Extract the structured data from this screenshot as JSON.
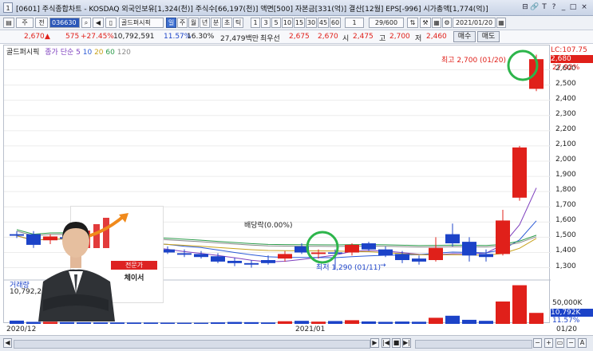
{
  "window": {
    "tab_number": "1",
    "title": "[0601] 주식종합차트 - KOSDAQ 외국인보유[1,324(천)] 주식수[66,197(천)] 액면[500] 자본금[331(억)] 결산[12월] EPS[-996] 시가총액[1,774(억)]",
    "controls": [
      "⊟",
      "🔗",
      "T",
      "?",
      "_",
      "□",
      "×"
    ]
  },
  "toolbar": {
    "market": "주",
    "jeon": "전",
    "stock_code": "036630",
    "stock_name": "골드퍼시픽",
    "periods": [
      "일",
      "주",
      "월",
      "년",
      "분",
      "초",
      "틱"
    ],
    "selected_period": "일",
    "minutes": [
      "1",
      "3",
      "5",
      "10",
      "15",
      "30",
      "45",
      "60"
    ],
    "interval_value": "1",
    "page_counter": "29/600",
    "date": "2021/01/20"
  },
  "pricebar": {
    "price": "2,670",
    "change": "575",
    "change_pct": "+27.45%",
    "volume": "10,792,591",
    "turnover": "11.57%",
    "rate2": "16.30%",
    "amount": "27,479백만",
    "best_sell_label": "최우선",
    "best_ask": "2,675",
    "best_bid": "2,670",
    "open_label": "시",
    "open": "2,475",
    "high_label": "고",
    "high": "2,700",
    "low_label": "저",
    "low": "2,460",
    "buy_button": "매수",
    "sell_button": "매도"
  },
  "legend": {
    "stock": "골드퍼시픽",
    "indicator": "종가 단순",
    "periods": [
      "5",
      "10",
      "20",
      "60",
      "120"
    ],
    "period_colors": [
      "#7e3fbe",
      "#2b5ad6",
      "#c8a21c",
      "#2b9b4a",
      "#8a8a8a"
    ]
  },
  "annotations": {
    "high": "최고 2,700 (01/20)",
    "low": "최저 1,290 (01/11)",
    "dividend": "배당락(0.00%)",
    "lc": "LC:107.75",
    "current_price_tag": "2,680",
    "current_pct_tag": "27.92%",
    "volume_label": "거래량",
    "volume_value": "10,792,23",
    "volume_tag": "10,792K",
    "volume_pct_tag": "11.57%",
    "vol_tick": "50,000K",
    "date_left": "2020/12",
    "date_mid": "2021/01",
    "date_right": "01/20"
  },
  "promo": {
    "title": "전문가",
    "name": "체이서"
  },
  "chart_data": {
    "type": "candlestick",
    "yaxis_ticks": [
      "2,600",
      "2,500",
      "2,400",
      "2,300",
      "2,200",
      "2,100",
      "2,000",
      "1,900",
      "1,800",
      "1,700",
      "1,600",
      "1,500",
      "1,400",
      "1,300"
    ],
    "ylim": [
      1240,
      2760
    ],
    "candles": [
      {
        "o": 1520,
        "h": 1540,
        "l": 1495,
        "c": 1510
      },
      {
        "o": 1520,
        "h": 1540,
        "l": 1430,
        "c": 1450
      },
      {
        "o": 1480,
        "h": 1520,
        "l": 1455,
        "c": 1505
      },
      {
        "o": 1500,
        "h": 1520,
        "l": 1460,
        "c": 1490
      },
      {
        "o": 1490,
        "h": 1510,
        "l": 1450,
        "c": 1470
      },
      {
        "o": 1470,
        "h": 1495,
        "l": 1440,
        "c": 1460
      },
      {
        "o": 1455,
        "h": 1480,
        "l": 1420,
        "c": 1430
      },
      {
        "o": 1440,
        "h": 1460,
        "l": 1400,
        "c": 1410
      },
      {
        "o": 1430,
        "h": 1450,
        "l": 1400,
        "c": 1405
      },
      {
        "o": 1420,
        "h": 1440,
        "l": 1390,
        "c": 1400
      },
      {
        "o": 1395,
        "h": 1420,
        "l": 1370,
        "c": 1385
      },
      {
        "o": 1390,
        "h": 1410,
        "l": 1360,
        "c": 1370
      },
      {
        "o": 1375,
        "h": 1395,
        "l": 1330,
        "c": 1340
      },
      {
        "o": 1345,
        "h": 1365,
        "l": 1310,
        "c": 1330
      },
      {
        "o": 1330,
        "h": 1350,
        "l": 1300,
        "c": 1320
      },
      {
        "o": 1350,
        "h": 1380,
        "l": 1320,
        "c": 1330
      },
      {
        "o": 1360,
        "h": 1410,
        "l": 1340,
        "c": 1390
      },
      {
        "o": 1440,
        "h": 1460,
        "l": 1390,
        "c": 1400
      },
      {
        "o": 1390,
        "h": 1420,
        "l": 1360,
        "c": 1400
      },
      {
        "o": 1400,
        "h": 1420,
        "l": 1290,
        "c": 1395
      },
      {
        "o": 1400,
        "h": 1460,
        "l": 1380,
        "c": 1450
      },
      {
        "o": 1460,
        "h": 1470,
        "l": 1410,
        "c": 1420
      },
      {
        "o": 1420,
        "h": 1440,
        "l": 1370,
        "c": 1380
      },
      {
        "o": 1390,
        "h": 1410,
        "l": 1330,
        "c": 1350
      },
      {
        "o": 1360,
        "h": 1380,
        "l": 1320,
        "c": 1340
      },
      {
        "o": 1350,
        "h": 1500,
        "l": 1340,
        "c": 1430
      },
      {
        "o": 1520,
        "h": 1590,
        "l": 1440,
        "c": 1460
      },
      {
        "o": 1470,
        "h": 1500,
        "l": 1340,
        "c": 1380
      },
      {
        "o": 1390,
        "h": 1420,
        "l": 1340,
        "c": 1370
      },
      {
        "o": 1390,
        "h": 1680,
        "l": 1380,
        "c": 1610
      },
      {
        "o": 1760,
        "h": 2100,
        "l": 1740,
        "c": 2090
      },
      {
        "o": 2475,
        "h": 2700,
        "l": 2460,
        "c": 2670
      }
    ],
    "volume": [
      3200,
      2000,
      2100,
      1800,
      1600,
      1500,
      1400,
      1300,
      1300,
      1200,
      1100,
      1100,
      1500,
      1900,
      1700,
      1400,
      2600,
      3000,
      2200,
      2800,
      3600,
      2400,
      2000,
      2300,
      2100,
      6000,
      8000,
      4000,
      3000,
      22000,
      38000,
      10800
    ]
  }
}
